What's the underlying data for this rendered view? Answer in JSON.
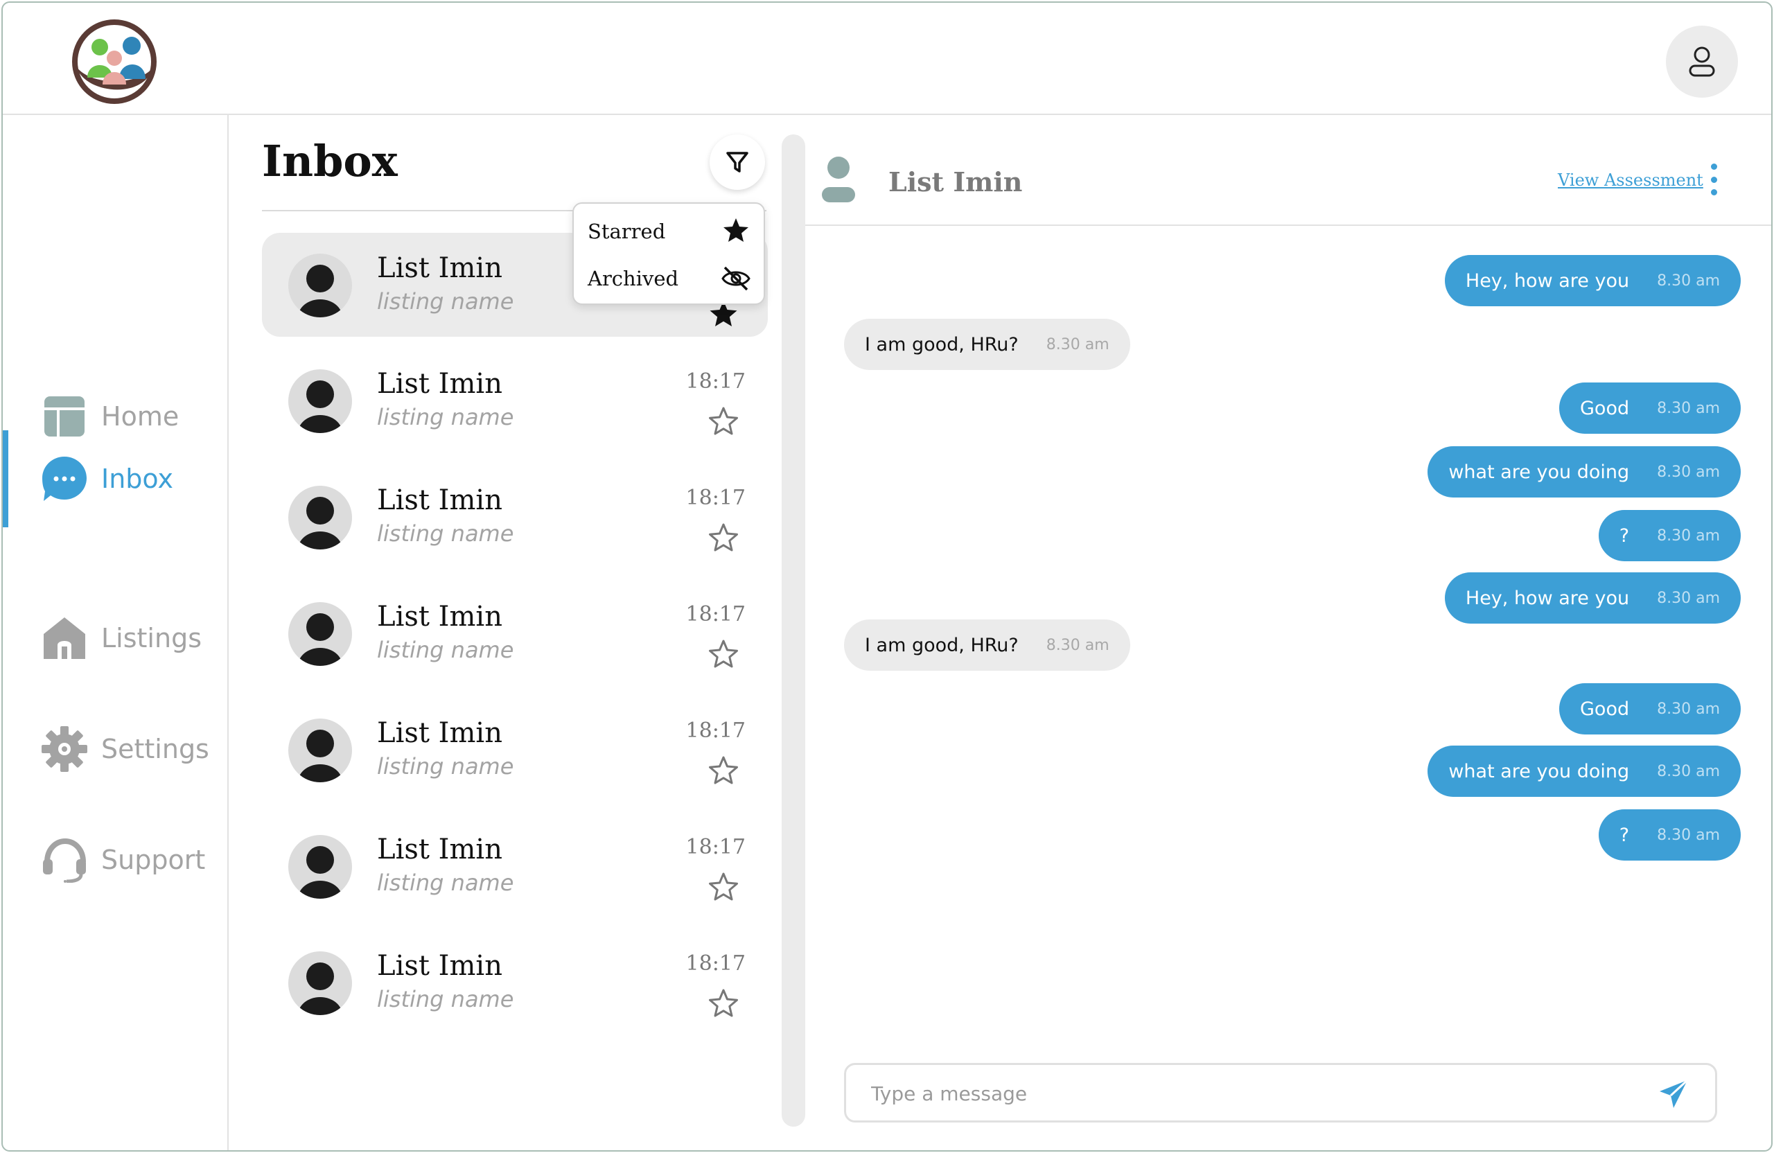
{
  "colors": {
    "accent": "#3d9fd6",
    "muted": "#a3a3a3",
    "bubble_in": "#ebebeb",
    "border": "#a9bdb5"
  },
  "nav": {
    "items": [
      {
        "label": "Home",
        "icon": "home-icon"
      },
      {
        "label": "Inbox",
        "icon": "chat-icon",
        "active": true
      },
      {
        "label": "Listings",
        "icon": "listings-house-icon"
      },
      {
        "label": "Settings",
        "icon": "gear-icon"
      },
      {
        "label": "Support",
        "icon": "headset-icon"
      }
    ]
  },
  "inbox": {
    "title": "Inbox",
    "filter_icon": "filter-icon",
    "filter_menu": {
      "items": [
        {
          "label": "Starred",
          "icon": "star-filled-icon"
        },
        {
          "label": "Archived",
          "icon": "eye-off-icon"
        }
      ]
    },
    "conversations": [
      {
        "name": "List Imin",
        "subtitle": "listing name",
        "time": "",
        "selected": true
      },
      {
        "name": "List Imin",
        "subtitle": "listing name",
        "time": "18:17"
      },
      {
        "name": "List Imin",
        "subtitle": "listing name",
        "time": "18:17"
      },
      {
        "name": "List Imin",
        "subtitle": "listing name",
        "time": "18:17"
      },
      {
        "name": "List Imin",
        "subtitle": "listing name",
        "time": "18:17"
      },
      {
        "name": "List Imin",
        "subtitle": "listing name",
        "time": "18:17"
      },
      {
        "name": "List Imin",
        "subtitle": "listing name",
        "time": "18:17"
      }
    ]
  },
  "chat": {
    "contact_name": "List Imin",
    "view_link": "View Assessment",
    "messages": [
      {
        "dir": "out",
        "text": "Hey, how are you",
        "time": "8.30 am"
      },
      {
        "dir": "in",
        "text": "I am good, HRu?",
        "time": "8.30 am"
      },
      {
        "dir": "out",
        "text": "Good",
        "time": "8.30 am"
      },
      {
        "dir": "out",
        "text": "what are you doing",
        "time": "8.30 am"
      },
      {
        "dir": "out",
        "text": "?",
        "time": "8.30 am"
      },
      {
        "dir": "out",
        "text": "Hey, how are you",
        "time": "8.30 am"
      },
      {
        "dir": "in",
        "text": "I am good, HRu?",
        "time": "8.30 am"
      },
      {
        "dir": "out",
        "text": "Good",
        "time": "8.30 am"
      },
      {
        "dir": "out",
        "text": "what are you doing",
        "time": "8.30 am"
      },
      {
        "dir": "out",
        "text": "?",
        "time": "8.30 am"
      }
    ],
    "composer": {
      "placeholder": "Type a message",
      "value": ""
    }
  }
}
